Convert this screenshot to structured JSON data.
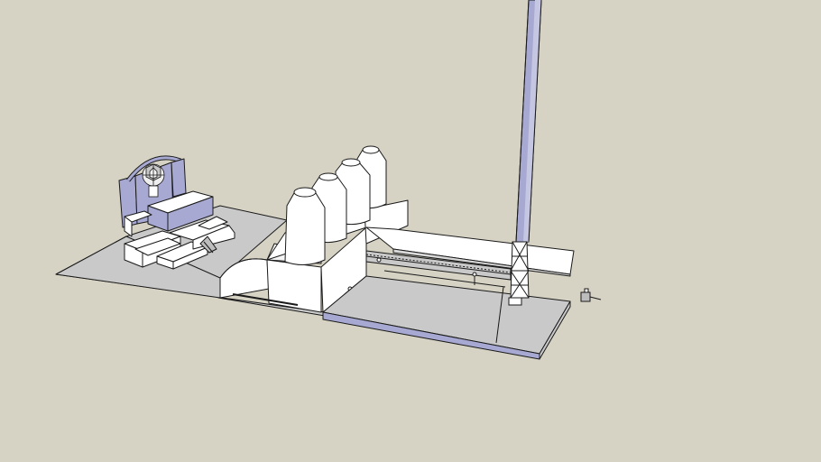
{
  "scene": {
    "background_color": "#d6d3c4",
    "face_color": "#ffffff",
    "ground_color": "#c9c9c9",
    "back_face_color": "#a7a9d2",
    "edge_color": "#1a1a1a",
    "objects": [
      "ground-slab",
      "control-building",
      "radome",
      "boiler-house",
      "silos",
      "conveyor-bridge",
      "coal-yard",
      "chimney",
      "lattice-tower",
      "human-figure"
    ]
  }
}
